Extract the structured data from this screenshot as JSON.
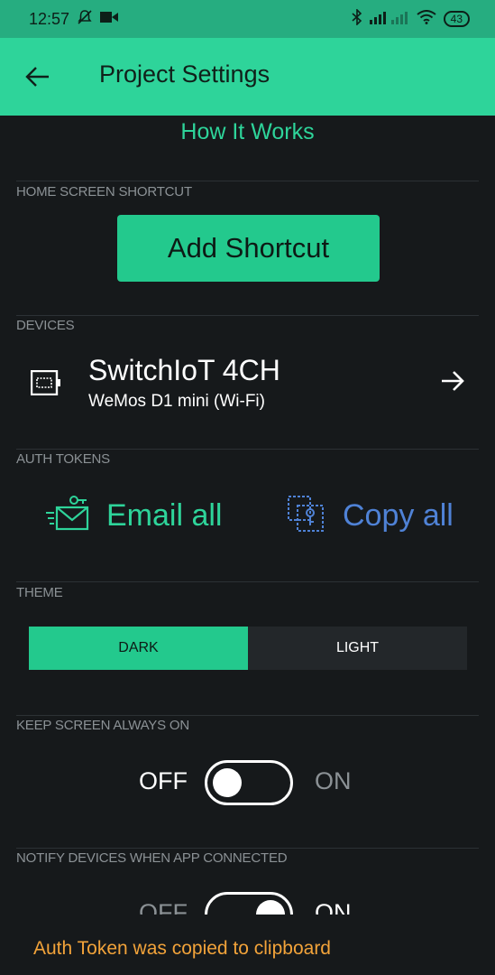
{
  "status_bar": {
    "time": "12:57",
    "battery": "43"
  },
  "app_bar": {
    "title": "Project Settings"
  },
  "how_it_works": "How It Works",
  "sections": {
    "home_screen_shortcut": {
      "label": "HOME SCREEN SHORTCUT",
      "button_label": "Add Shortcut"
    },
    "devices": {
      "label": "DEVICES",
      "device": {
        "name": "SwitchIoT 4CH",
        "board": "WeMos D1 mini (Wi-Fi)"
      }
    },
    "auth_tokens": {
      "label": "AUTH TOKENS",
      "email_all": "Email all",
      "copy_all": "Copy all"
    },
    "theme": {
      "label": "THEME",
      "options": [
        "DARK",
        "LIGHT"
      ],
      "selected": "DARK"
    },
    "keep_screen_on": {
      "label": "KEEP SCREEN ALWAYS ON",
      "off_label": "OFF",
      "on_label": "ON",
      "state": "OFF"
    },
    "notify_devices": {
      "label": "NOTIFY DEVICES WHEN APP CONNECTED",
      "off_label": "OFF",
      "on_label": "ON",
      "state": "ON"
    }
  },
  "toast": "Auth Token was copied to clipboard",
  "colors": {
    "accent": "#2ed49a",
    "background": "#16191b",
    "copy_blue": "#4f82d6",
    "toast_orange": "#f2a33a",
    "muted": "#8b9195"
  },
  "icons": [
    "mute-icon",
    "video-icon",
    "bluetooth-icon",
    "signal-icon",
    "wifi-icon",
    "battery-icon",
    "back-arrow-icon",
    "device-chip-icon",
    "arrow-right-icon",
    "email-key-icon",
    "copy-key-icon"
  ]
}
